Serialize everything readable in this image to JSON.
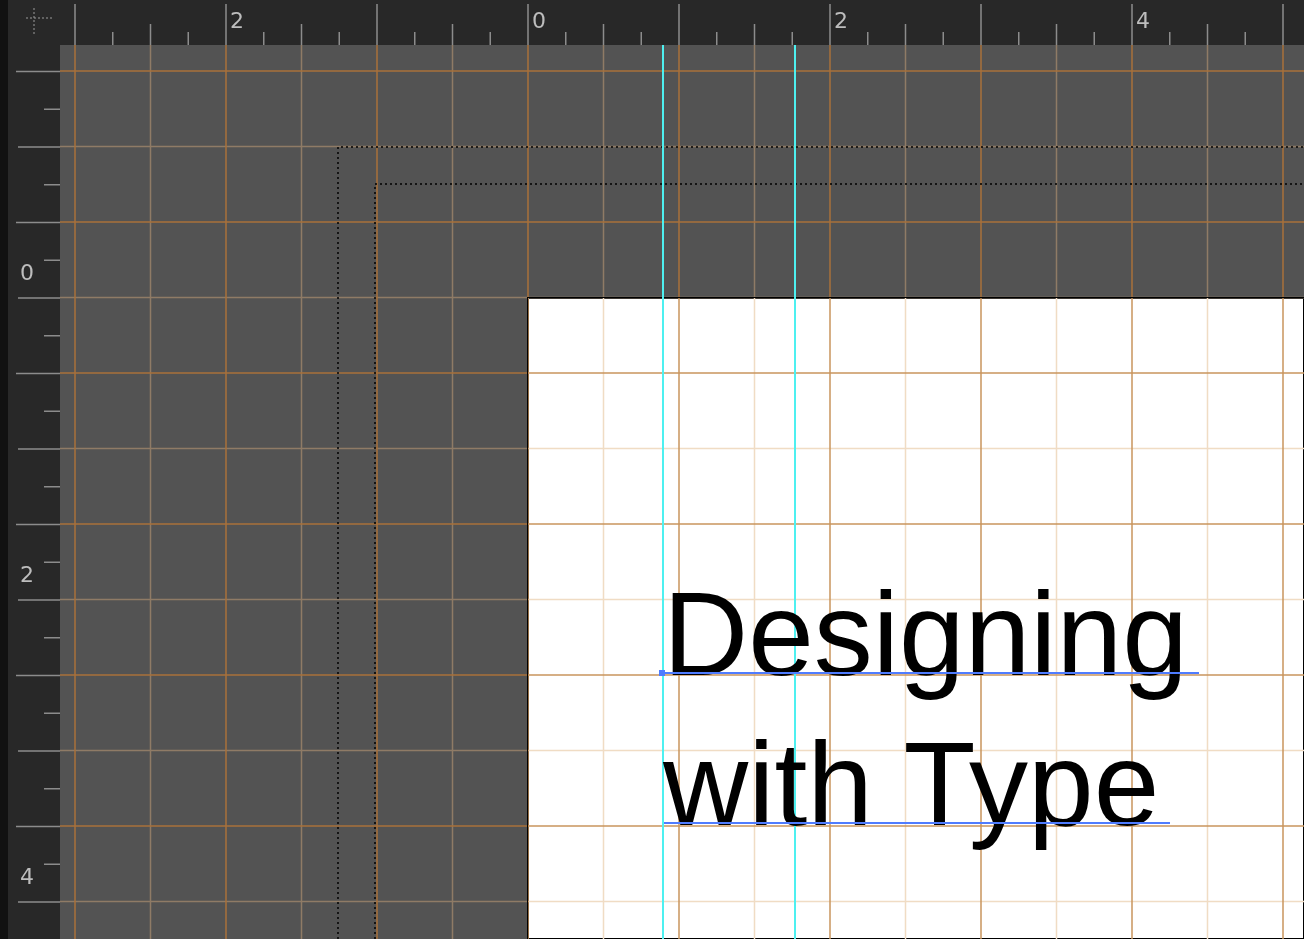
{
  "ruler_top": {
    "labels": [
      "2",
      "0",
      "2",
      "4"
    ]
  },
  "ruler_left": {
    "labels": [
      "0",
      "2",
      "4"
    ]
  },
  "text_frame": {
    "lines": [
      "Designing",
      "with Type"
    ]
  }
}
